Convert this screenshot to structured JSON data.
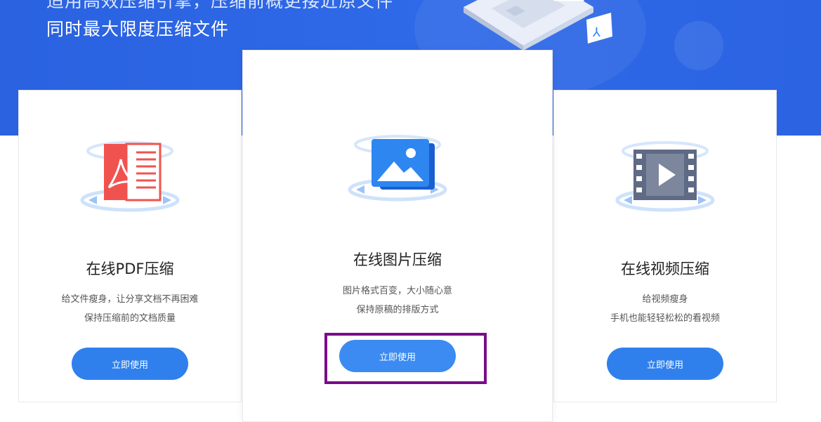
{
  "hero": {
    "line1": "适用高效压缩引擎，压缩前概更接近原文件",
    "line2": "同时最大限度压缩文件"
  },
  "cards": [
    {
      "title": "在线PDF压缩",
      "desc1": "给文件瘦身，让分享文档不再困难",
      "desc2": "保持压缩前的文档质量",
      "button": "立即使用",
      "icon": "pdf-file-icon"
    },
    {
      "title": "在线图片压缩",
      "desc1": "图片格式百变，大小随心意",
      "desc2": "保持原稿的排版方式",
      "button": "立即使用",
      "icon": "image-icon"
    },
    {
      "title": "在线视频压缩",
      "desc1": "给视频瘦身",
      "desc2": "手机也能轻轻松松的看视频",
      "button": "立即使用",
      "icon": "video-film-icon"
    }
  ],
  "colors": {
    "hero_blue": "#2a62e0",
    "button_blue": "#2f80ed",
    "highlight_purple": "#7a0c8a",
    "pdf_red": "#f0534f",
    "image_blue": "#2e86f0",
    "video_gray": "#5f6b84"
  }
}
